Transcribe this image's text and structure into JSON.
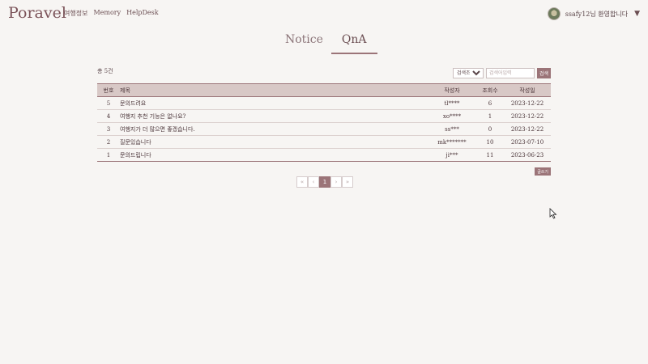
{
  "nav": {
    "logo": "Poravel",
    "links": [
      "여행정보",
      "Memory",
      "HelpDesk"
    ],
    "user_greeting": "ssafy12님 환영합니다",
    "caret": "▼"
  },
  "tabs": [
    {
      "label": "Notice",
      "active": false
    },
    {
      "label": "QnA",
      "active": true
    }
  ],
  "board": {
    "total": "총 5건",
    "search": {
      "select_value": "검색조건",
      "placeholder": "검색어입력",
      "button": "검색"
    },
    "headers": {
      "no": "번호",
      "title": "제목",
      "author": "작성자",
      "views": "조회수",
      "date": "작성일"
    },
    "rows": [
      {
        "no": "5",
        "title": "문의드려요",
        "author": "tl****",
        "views": "6",
        "date": "2023-12-22"
      },
      {
        "no": "4",
        "title": "여행지 추천 기능은 없나요?",
        "author": "xo****",
        "views": "1",
        "date": "2023-12-22"
      },
      {
        "no": "3",
        "title": "여행지가 더 많으면 좋겠습니다.",
        "author": "ss***",
        "views": "0",
        "date": "2023-12-22"
      },
      {
        "no": "2",
        "title": "질문있습니다",
        "author": "mk*******",
        "views": "10",
        "date": "2023-07-10"
      },
      {
        "no": "1",
        "title": "문의드립니다",
        "author": "ji***",
        "views": "11",
        "date": "2023-06-23"
      }
    ],
    "write_button": "글쓰기"
  },
  "pager": {
    "first": "«",
    "prev": "‹",
    "current": "1",
    "next": "›",
    "last": "»"
  },
  "colors": {
    "accent": "#9b7478",
    "header_bg": "#d8c8c6",
    "background": "#f7f5f3"
  }
}
